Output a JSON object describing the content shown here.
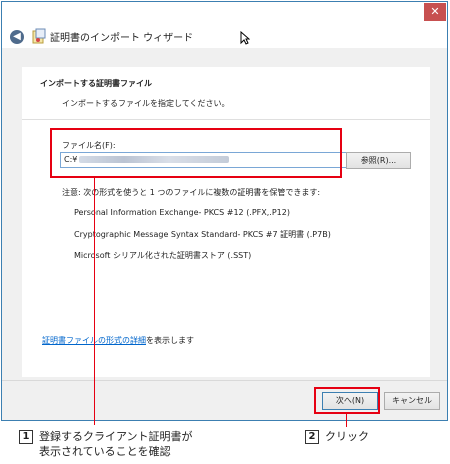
{
  "window": {
    "title": "証明書のインポート ウィザード",
    "close_glyph": "✕",
    "back_glyph": "◀"
  },
  "section": {
    "heading": "インポートする証明書ファイル",
    "subheading": "インポートするファイルを指定してください。"
  },
  "file_field": {
    "label": "ファイル名(F):",
    "value_prefix": "C:¥",
    "browse_label": "参照(R)..."
  },
  "note": {
    "text": "注意: 次の形式を使うと 1 つのファイルに複数の証明書を保管できます:",
    "formats": [
      "Personal Information Exchange- PKCS #12 (.PFX,.P12)",
      "Cryptographic Message Syntax Standard- PKCS #7 証明書 (.P7B)",
      "Microsoft シリアル化された証明書ストア (.SST)"
    ]
  },
  "help_link": {
    "link_text": "証明書ファイルの形式の詳細",
    "suffix": "を表示します"
  },
  "buttons": {
    "next_label": "次へ(N)",
    "cancel_label": "キャンセル"
  },
  "callouts": [
    {
      "number": "1",
      "line1": "登録するクライアント証明書が",
      "line2": "表示されていることを確認"
    },
    {
      "number": "2",
      "line1": "クリック"
    }
  ],
  "colors": {
    "highlight": "#e60012",
    "link": "#0066cc",
    "title_border": "#3c7fb1"
  }
}
